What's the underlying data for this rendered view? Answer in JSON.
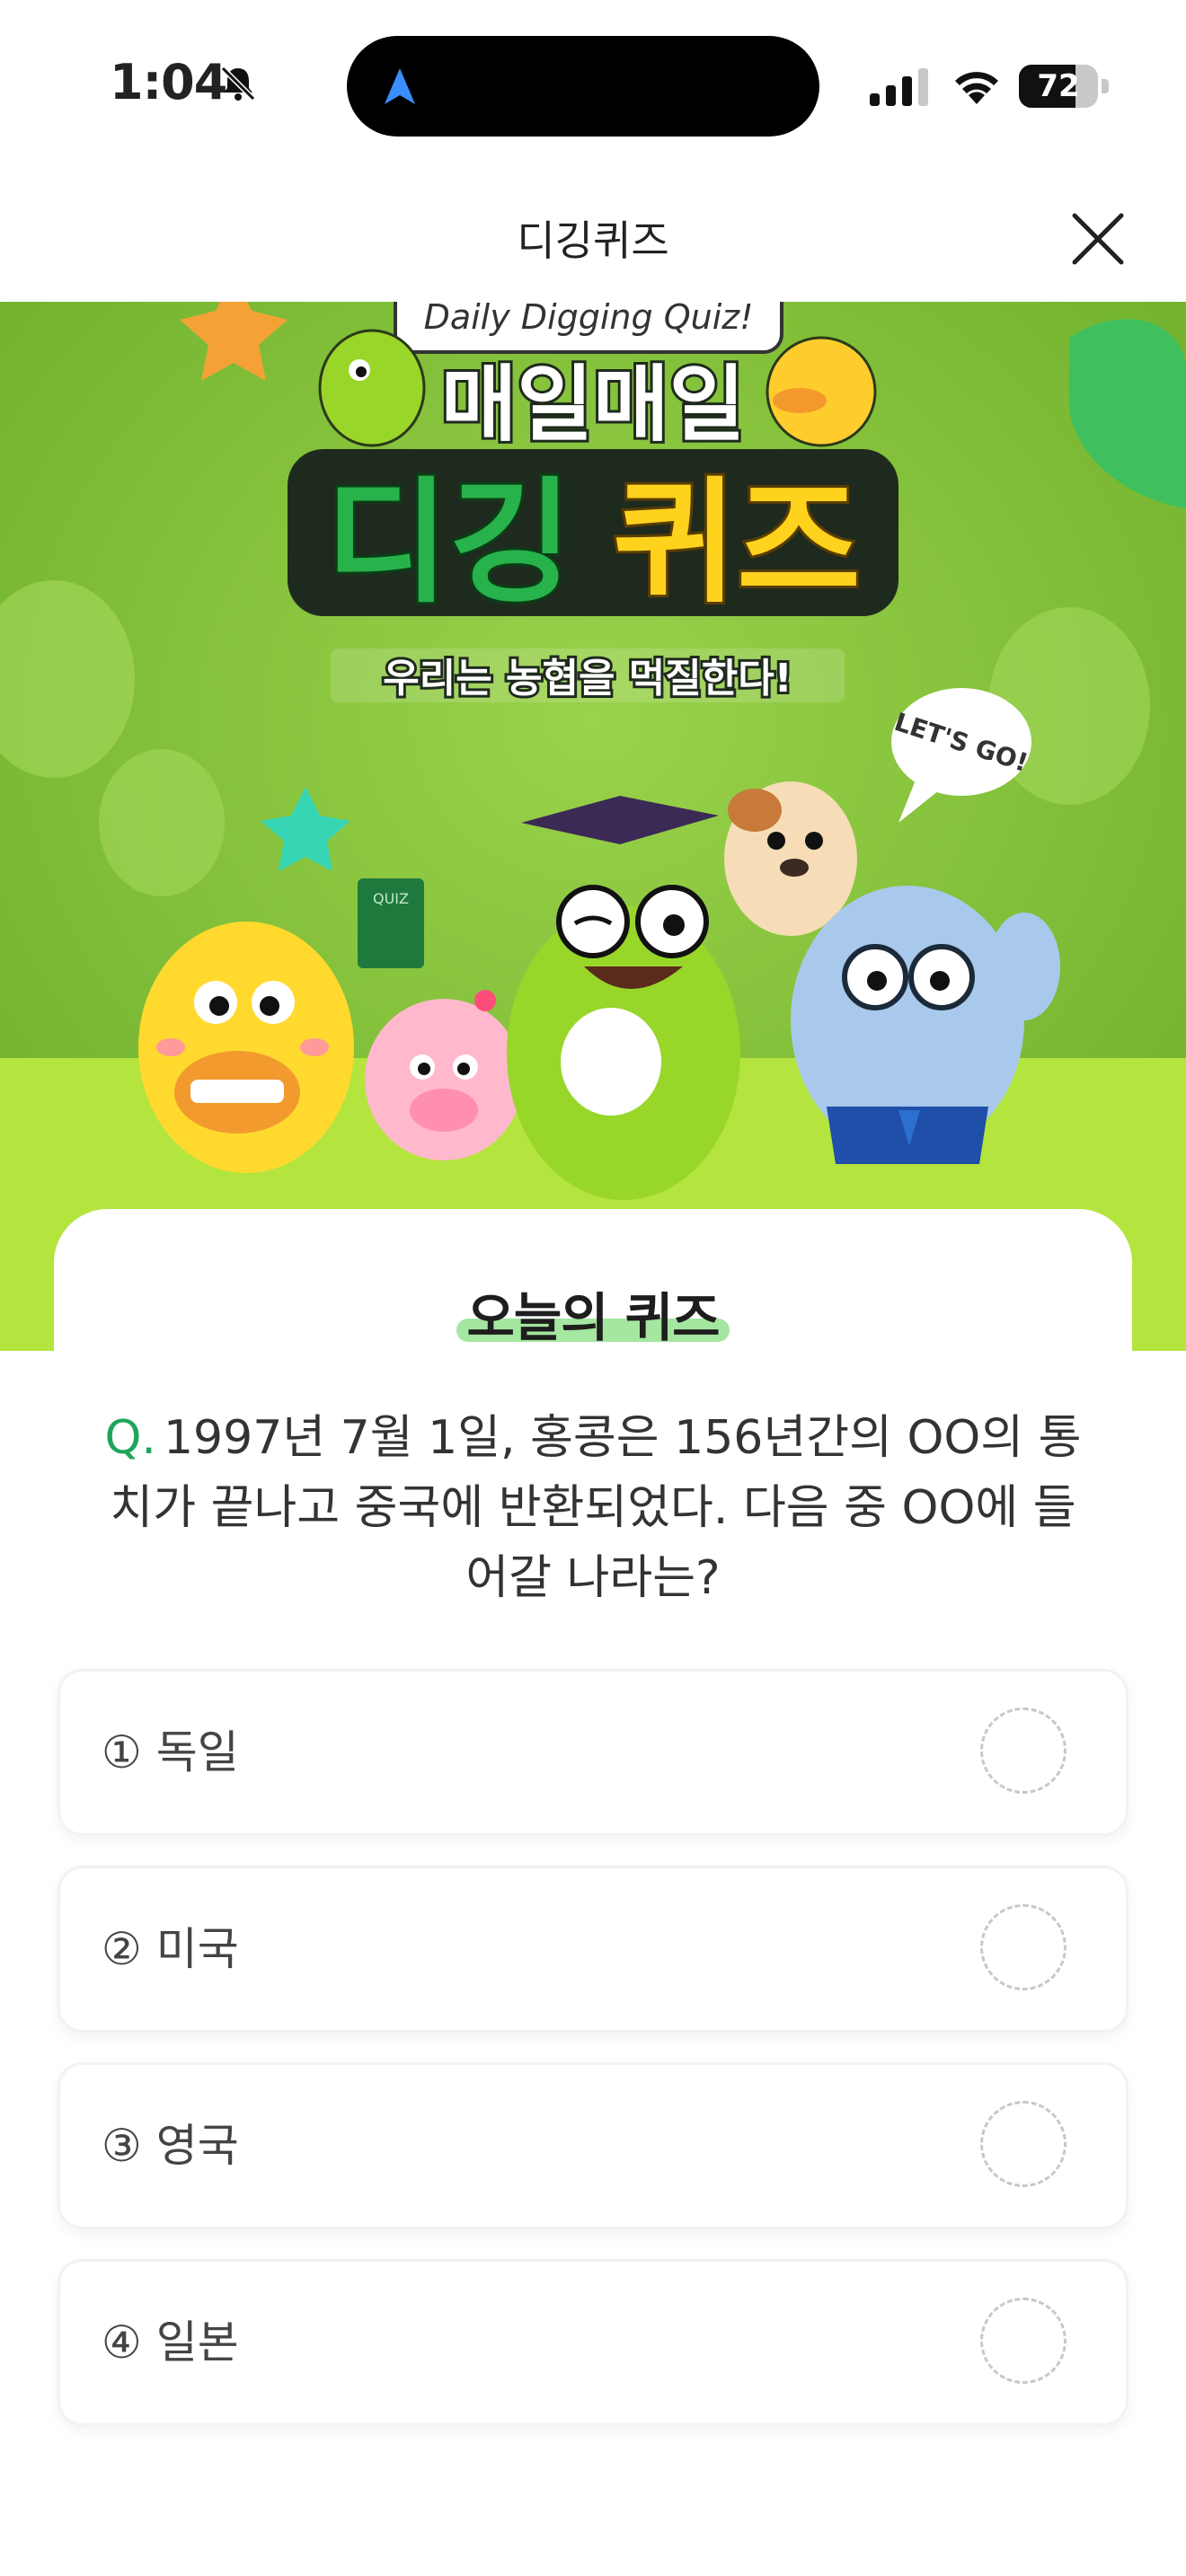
{
  "status_bar": {
    "time": "1:04",
    "battery": "72",
    "battery_level": 0.72
  },
  "header": {
    "title": "디깅퀴즈"
  },
  "banner": {
    "tagline": "Daily Digging Quiz!",
    "title_line1": "매일매일",
    "title_line2_green": "디깅",
    "title_line2_yellow": "퀴즈",
    "subtitle": "우리는 농협을 먹질한다!",
    "speech": "LET'S GO!",
    "book_label": "QUIZ"
  },
  "quiz": {
    "section_title": "오늘의 퀴즈",
    "q_prefix": "Q.",
    "question": "1997년 7월 1일, 홍콩은 156년간의 OO의 통치가 끝나고 중국에 반환되었다. 다음 중 OO에 들어갈 나라는?",
    "options": [
      {
        "label": "① 독일"
      },
      {
        "label": "② 미국"
      },
      {
        "label": "③ 영국"
      },
      {
        "label": "④ 일본"
      }
    ]
  },
  "colors": {
    "accent_green": "#1ea55a",
    "banner_bg": "#86c83c",
    "banner_floor": "#b4e43e"
  }
}
